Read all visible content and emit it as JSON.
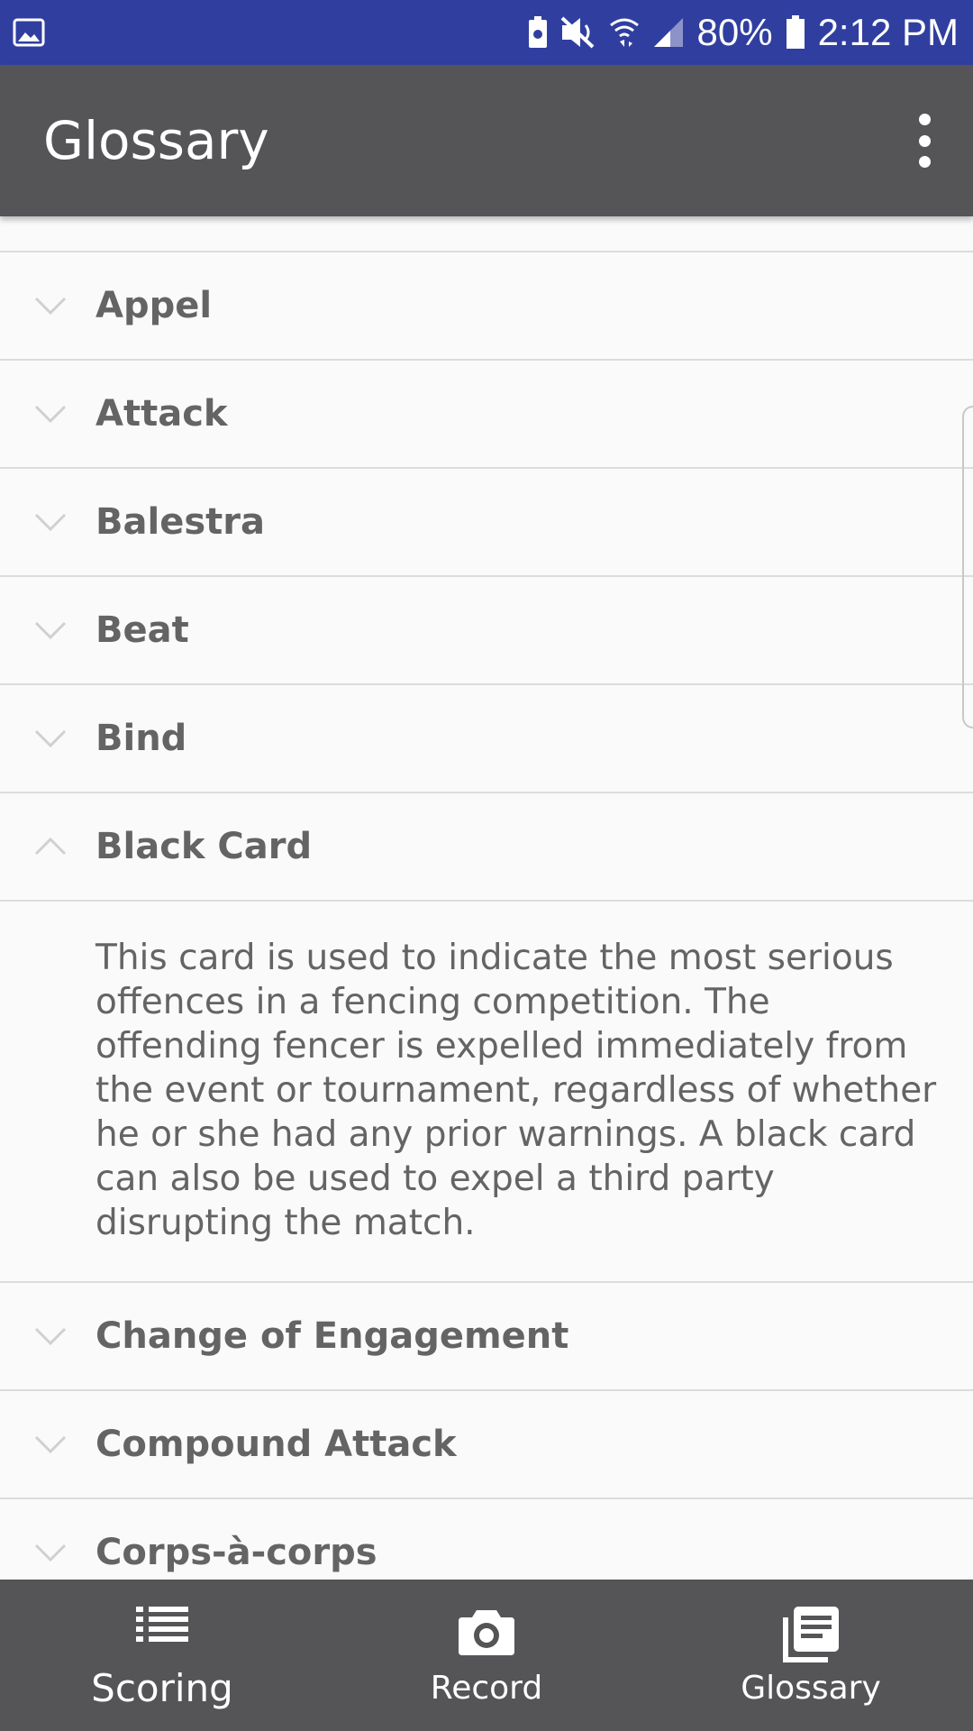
{
  "status_bar": {
    "battery_percent": "80%",
    "time": "2:12 PM",
    "icons": [
      "image-icon",
      "battery-saver-icon",
      "mute-icon",
      "wifi-icon",
      "signal-icon",
      "battery-icon"
    ]
  },
  "app_bar": {
    "title": "Glossary",
    "menu_icon": "more-vert-icon"
  },
  "glossary": {
    "items": [
      {
        "term": "Appel",
        "expanded": false
      },
      {
        "term": "Attack",
        "expanded": false
      },
      {
        "term": "Balestra",
        "expanded": false
      },
      {
        "term": "Beat",
        "expanded": false
      },
      {
        "term": "Bind",
        "expanded": false
      },
      {
        "term": "Black Card",
        "expanded": true,
        "definition": "This card is used to indicate the most serious offences in a fencing competition. The offending fencer is expelled immediately from the event or tournament, regardless of whether he or she had any prior warnings. A black card can also be used to expel a third party disrupting the match."
      },
      {
        "term": "Change of Engagement",
        "expanded": false
      },
      {
        "term": "Compound Attack",
        "expanded": false
      },
      {
        "term": "Corps-à-corps",
        "expanded": false
      }
    ]
  },
  "bottom_nav": {
    "items": [
      {
        "label": "Scoring",
        "icon": "list-icon",
        "active": true
      },
      {
        "label": "Record",
        "icon": "camera-icon",
        "active": false
      },
      {
        "label": "Glossary",
        "icon": "library-books-icon",
        "active": false
      }
    ]
  },
  "colors": {
    "status_bar": "#303f9f",
    "app_bar": "#555456",
    "text": "#646464",
    "background": "#fafafa"
  }
}
